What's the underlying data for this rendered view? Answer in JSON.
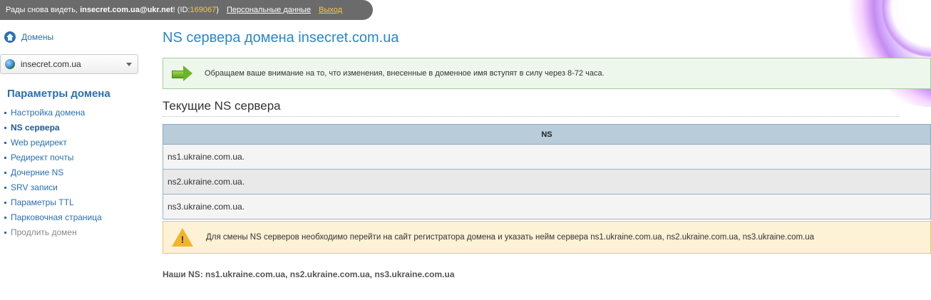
{
  "topbar": {
    "greeting": "Рады снова видеть, ",
    "user": "insecret.com.ua@ukr.net",
    "id_prefix": "! (ID:",
    "id_value": "169067",
    "id_suffix": ")",
    "personal_link": "Персональные данные",
    "logout_link": "Выход"
  },
  "sidebar": {
    "domains_link": "Домены",
    "selected_domain": "insecret.com.ua",
    "section_title": "Параметры домена",
    "items": [
      {
        "label": "Настройка домена",
        "state": "normal"
      },
      {
        "label": "NS сервера",
        "state": "active"
      },
      {
        "label": "Web редирект",
        "state": "normal"
      },
      {
        "label": "Редирект почты",
        "state": "normal"
      },
      {
        "label": "Дочерние NS",
        "state": "normal"
      },
      {
        "label": "SRV записи",
        "state": "normal"
      },
      {
        "label": "Параметры TTL",
        "state": "normal"
      },
      {
        "label": "Парковочная страница",
        "state": "normal"
      },
      {
        "label": "Продлить домен",
        "state": "disabled"
      }
    ]
  },
  "main": {
    "page_title": "NS сервера домена insecret.com.ua",
    "info_notice": "Обращаем ваше внимание на то, что изменения, внесенные в доменное имя вступят в силу через 8-72 часа.",
    "section_title": "Текущие NS сервера",
    "table": {
      "header": "NS",
      "rows": [
        "ns1.ukraine.com.ua.",
        "ns2.ukraine.com.ua.",
        "ns3.ukraine.com.ua."
      ]
    },
    "warning_notice": "Для смены NS серверов необходимо перейти на сайт регистратора домена и указать нейм сервера ns1.ukraine.com.ua, ns2.ukraine.com.ua, ns3.ukraine.com.ua",
    "our_ns": "Наши NS: ns1.ukraine.com.ua, ns2.ukraine.com.ua, ns3.ukraine.com.ua"
  },
  "colors": {
    "link_blue": "#2a6fb0",
    "title_blue": "#2a86d0",
    "topbar_bg": "#6b6b6b",
    "topbar_accent": "#f5c842",
    "info_bg": "#eef7ec",
    "warning_bg": "#fdf2d6",
    "table_header_bg": "#b8ccd9"
  },
  "icons": {
    "domains": "home-icon",
    "domain_select": "globe-icon",
    "info_notice": "arrow-right-icon",
    "warning_notice": "warning-icon"
  }
}
